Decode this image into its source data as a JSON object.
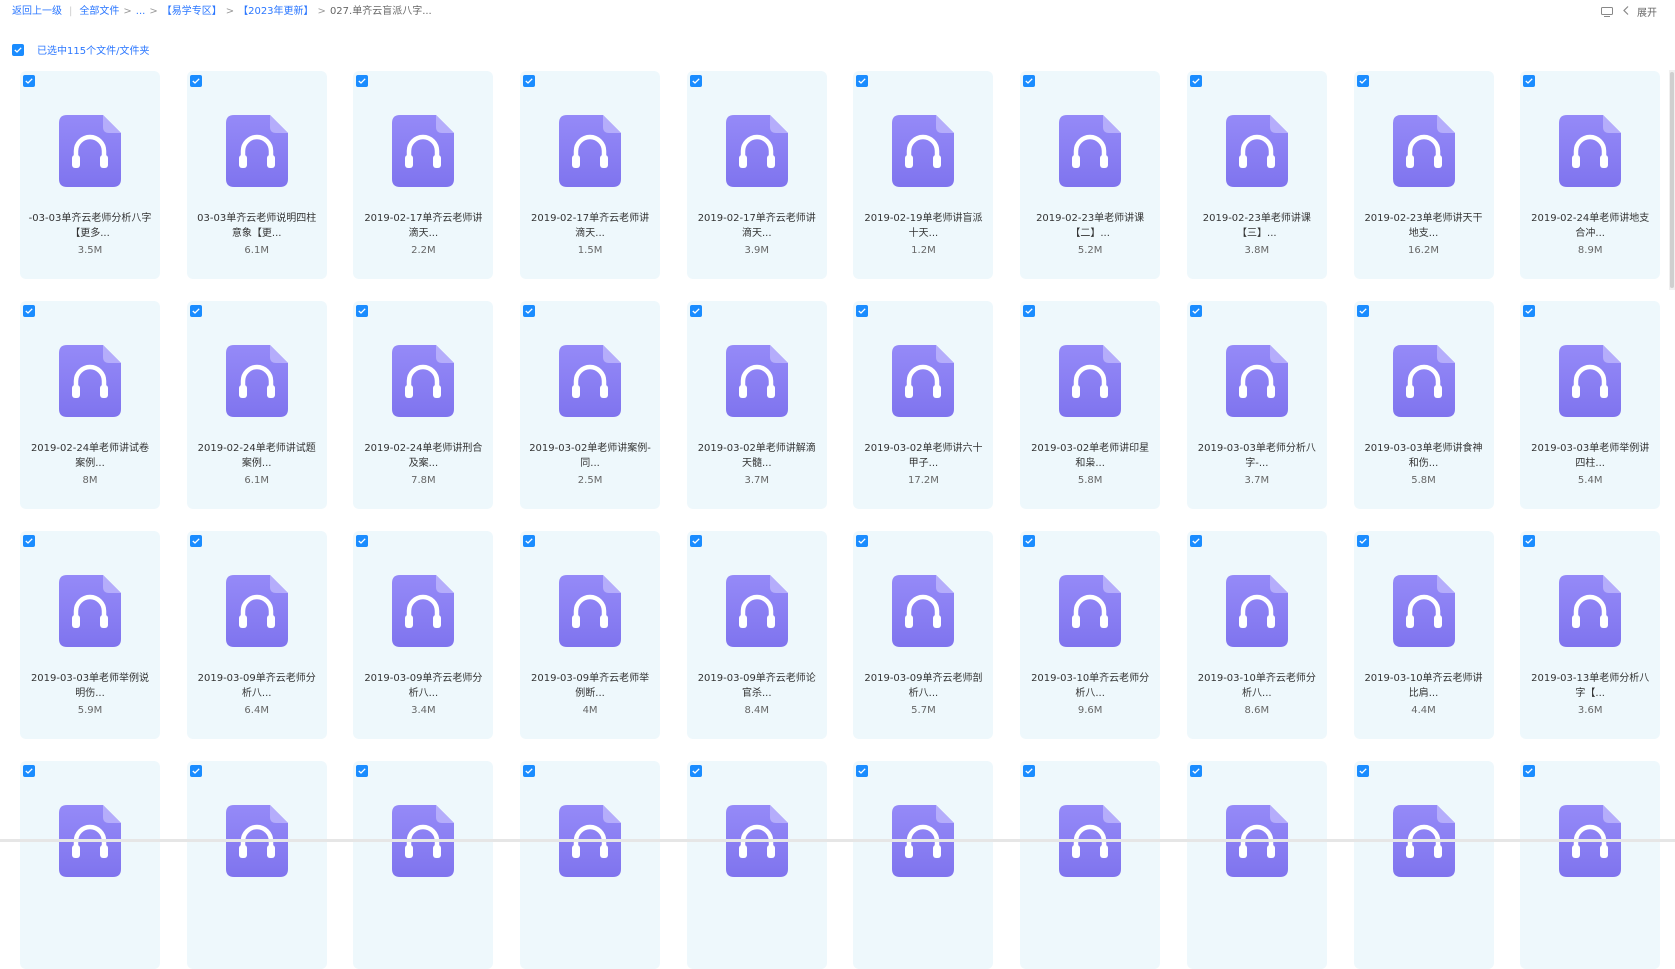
{
  "breadcrumb": {
    "back": "返回上一级",
    "items": [
      "全部文件",
      "...",
      "【易学专区】",
      "【2023年更新】"
    ],
    "current": "027.单齐云盲派八字..."
  },
  "topright": {
    "expand_label": "展开"
  },
  "selection": {
    "text": "已选中115个文件/文件夹"
  },
  "colors": {
    "accent": "#1a8cff",
    "link": "#2b77ff",
    "card_bg": "#eef8fc",
    "icon_purple": "#8a7ff5"
  },
  "files": [
    {
      "name": "-03-03单齐云老师分析八字【更多...",
      "size": "3.5M"
    },
    {
      "name": "03-03单齐云老师说明四柱意象【更...",
      "size": "6.1M"
    },
    {
      "name": "2019-02-17单齐云老师讲滴天...",
      "size": "2.2M"
    },
    {
      "name": "2019-02-17单齐云老师讲滴天...",
      "size": "1.5M"
    },
    {
      "name": "2019-02-17单齐云老师讲滴天...",
      "size": "3.9M"
    },
    {
      "name": "2019-02-19单老师讲盲派十天...",
      "size": "1.2M"
    },
    {
      "name": "2019-02-23单老师讲课【二】...",
      "size": "5.2M"
    },
    {
      "name": "2019-02-23单老师讲课【三】...",
      "size": "3.8M"
    },
    {
      "name": "2019-02-23单老师讲天干地支...",
      "size": "16.2M"
    },
    {
      "name": "2019-02-24单老师讲地支合冲...",
      "size": "8.9M"
    },
    {
      "name": "2019-02-24单老师讲试卷案例...",
      "size": "8M"
    },
    {
      "name": "2019-02-24单老师讲试题案例...",
      "size": "6.1M"
    },
    {
      "name": "2019-02-24单老师讲刑合及案...",
      "size": "7.8M"
    },
    {
      "name": "2019-03-02单老师讲案例-同...",
      "size": "2.5M"
    },
    {
      "name": "2019-03-02单老师讲解滴天髓...",
      "size": "3.7M"
    },
    {
      "name": "2019-03-02单老师讲六十甲子...",
      "size": "17.2M"
    },
    {
      "name": "2019-03-02单老师讲印星和枭...",
      "size": "5.8M"
    },
    {
      "name": "2019-03-03单老师分析八字-...",
      "size": "3.7M"
    },
    {
      "name": "2019-03-03单老师讲食神和伤...",
      "size": "5.8M"
    },
    {
      "name": "2019-03-03单老师举例讲四柱...",
      "size": "5.4M"
    },
    {
      "name": "2019-03-03单老师举例说明伤...",
      "size": "5.9M"
    },
    {
      "name": "2019-03-09单齐云老师分析八...",
      "size": "6.4M"
    },
    {
      "name": "2019-03-09单齐云老师分析八...",
      "size": "3.4M"
    },
    {
      "name": "2019-03-09单齐云老师举例断...",
      "size": "4M"
    },
    {
      "name": "2019-03-09单齐云老师论官杀...",
      "size": "8.4M"
    },
    {
      "name": "2019-03-09单齐云老师剖析八...",
      "size": "5.7M"
    },
    {
      "name": "2019-03-10单齐云老师分析八...",
      "size": "9.6M"
    },
    {
      "name": "2019-03-10单齐云老师分析八...",
      "size": "8.6M"
    },
    {
      "name": "2019-03-10单齐云老师讲比肩...",
      "size": "4.4M"
    },
    {
      "name": "2019-03-13单老师分析八字【...",
      "size": "3.6M"
    },
    {
      "name": "",
      "size": ""
    },
    {
      "name": "",
      "size": ""
    },
    {
      "name": "",
      "size": ""
    },
    {
      "name": "",
      "size": ""
    },
    {
      "name": "",
      "size": ""
    },
    {
      "name": "",
      "size": ""
    },
    {
      "name": "",
      "size": ""
    },
    {
      "name": "",
      "size": ""
    },
    {
      "name": "",
      "size": ""
    },
    {
      "name": "",
      "size": ""
    }
  ]
}
